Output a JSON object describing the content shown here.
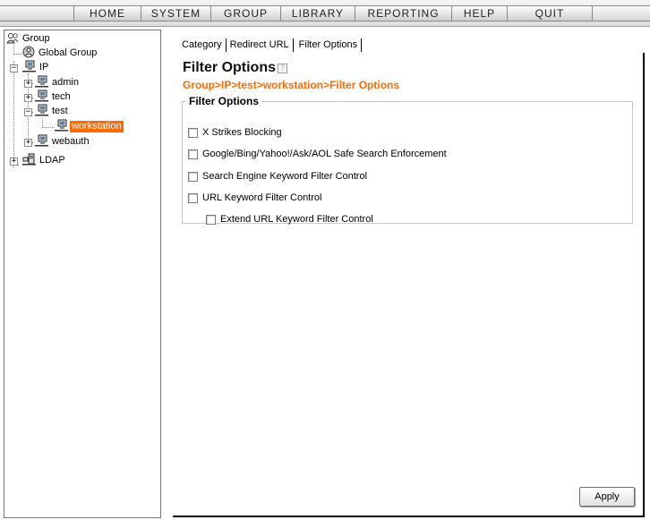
{
  "topnav": {
    "items": [
      "HOME",
      "SYSTEM",
      "GROUP",
      "LIBRARY",
      "REPORTING",
      "HELP",
      "QUIT"
    ]
  },
  "tree": {
    "root": "Group",
    "global_group": "Global Group",
    "ip": "IP",
    "admin": "admin",
    "tech": "tech",
    "test": "test",
    "workstation": "workstation",
    "webauth": "webauth",
    "ldap": "LDAP",
    "expanders": {
      "collapse": "−",
      "expand": "+"
    }
  },
  "tabs": [
    "Category",
    "Redirect URL",
    "Filter Options"
  ],
  "page": {
    "title": "Filter Options",
    "help_icon": "?",
    "breadcrumb": "Group>IP>test>workstation>Filter Options"
  },
  "filter_options": {
    "legend": "Filter Options",
    "items": [
      {
        "label": "X Strikes Blocking",
        "checked": false
      },
      {
        "label": "Google/Bing/Yahoo!/Ask/AOL Safe Search Enforcement",
        "checked": false
      },
      {
        "label": "Search Engine Keyword Filter Control",
        "checked": false
      },
      {
        "label": "URL Keyword Filter Control",
        "checked": false
      },
      {
        "label": "Extend URL Keyword Filter Control",
        "checked": false
      }
    ]
  },
  "buttons": {
    "apply": "Apply"
  },
  "colors": {
    "accent": "#ff6a00",
    "selected_bg": "#ff6a00"
  },
  "icons": {
    "group": "group-users-icon",
    "global_group": "global-group-icon",
    "network": "network-computer-icon",
    "ldap": "ldap-server-icon"
  }
}
